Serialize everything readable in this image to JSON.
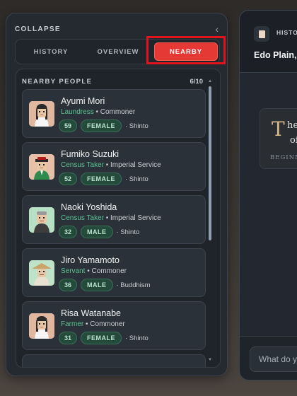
{
  "sidebar": {
    "collapse_label": "COLLAPSE",
    "collapse_icon": "chevron-left-icon",
    "tabs": [
      {
        "label": "HISTORY",
        "active": false
      },
      {
        "label": "OVERVIEW",
        "active": false
      },
      {
        "label": "NEARBY",
        "active": true
      }
    ]
  },
  "nearby": {
    "title": "NEARBY PEOPLE",
    "count": "6/10",
    "people": [
      {
        "name": "Ayumi Mori",
        "occupation": "Laundress",
        "class": "Commoner",
        "age": "59",
        "gender": "FEMALE",
        "religion": "· Shinto",
        "avatar": "female-avatar-icon"
      },
      {
        "name": "Fumiko Suzuki",
        "occupation": "Census Taker",
        "class": "Imperial Service",
        "age": "52",
        "gender": "FEMALE",
        "religion": "· Shinto",
        "avatar": "female-avatar-icon"
      },
      {
        "name": "Naoki Yoshida",
        "occupation": "Census Taker",
        "class": "Imperial Service",
        "age": "32",
        "gender": "MALE",
        "religion": "· Shinto",
        "avatar": "male-avatar-icon"
      },
      {
        "name": "Jiro Yamamoto",
        "occupation": "Servant",
        "class": "Commoner",
        "age": "36",
        "gender": "MALE",
        "religion": "· Buddhism",
        "avatar": "male-avatar-icon"
      },
      {
        "name": "Risa Watanabe",
        "occupation": "Farmer",
        "class": "Commoner",
        "age": "31",
        "gender": "FEMALE",
        "religion": "· Shinto",
        "avatar": "female-avatar-icon"
      }
    ]
  },
  "right_panel": {
    "tab_label": "HISTO",
    "location": "Edo Plain,",
    "story_dropcap": "T",
    "story_line1": "he",
    "story_line2": "of",
    "story_footer": "BEGINN",
    "input_placeholder": "What do y"
  },
  "colors": {
    "accent_red": "#e53935",
    "highlight_red": "#e0141a",
    "role_green": "#59c28f",
    "badge_green": "#244a3b"
  }
}
